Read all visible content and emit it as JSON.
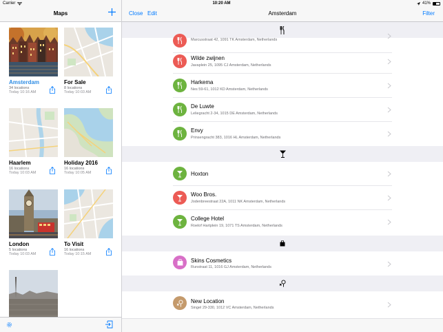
{
  "status_bar": {
    "carrier": "Carrier",
    "time": "10:20 AM",
    "battery": "41%"
  },
  "sidebar": {
    "title": "Maps",
    "maps": [
      {
        "name": "Amsterdam",
        "count": "34 locations",
        "time": "Today 10:16 AM",
        "selected": true
      },
      {
        "name": "For Sale",
        "count": "8 locations",
        "time": "Today 10:03 AM"
      },
      {
        "name": "Haarlem",
        "count": "16 locations",
        "time": "Today 10:03 AM"
      },
      {
        "name": "Holiday 2016",
        "count": "16 locations",
        "time": "Today 10:05 AM"
      },
      {
        "name": "London",
        "count": "5 locations",
        "time": "Today 10:03 AM"
      },
      {
        "name": "To Visit",
        "count": "16 locations",
        "time": "Today 10:15 AM"
      }
    ]
  },
  "detail": {
    "title": "Amsterdam",
    "close_label": "Close",
    "edit_label": "Edit",
    "filter_label": "Filter",
    "rows": [
      {
        "name": "",
        "address": "Marcusstraat 42, 1091 TK Amsterdam, Netherlands"
      },
      {
        "name": "Wilde zwijnen",
        "address": "Javaplein 25, 1095 CJ Amsterdam, Netherlands"
      },
      {
        "name": "Harkema",
        "address": "Nes 59-61, 1012 KD Amsterdam, Netherlands"
      },
      {
        "name": "De Luwte",
        "address": "Leliegracht 2-34, 1015 DE Amsterdam, Netherlands"
      },
      {
        "name": "Envy",
        "address": "Prinsengracht 383, 1016 HL Amsterdam, Netherlands"
      },
      {
        "name": "Hoxton",
        "address": ""
      },
      {
        "name": "Woo Bros.",
        "address": "Jodenbreestraat 22A, 1011 NK Amsterdam, Netherlands"
      },
      {
        "name": "College Hotel",
        "address": "Roelof Hartplein 19, 1071 TS Amsterdam, Netherlands"
      },
      {
        "name": "Skins Cosmetics",
        "address": "Runstraat 11, 1016 GJ Amsterdam, Netherlands"
      },
      {
        "name": "New Location",
        "address": "Singel 29-330, 1012 VC Amsterdam, Netherlands"
      }
    ]
  },
  "colors": {
    "accent": "#007aff",
    "selected_map": "#2f8de4",
    "red_category": "#ec5b55",
    "green_category": "#6db33f",
    "pink_category": "#d86fc7",
    "brown_category": "#c49a6c"
  }
}
